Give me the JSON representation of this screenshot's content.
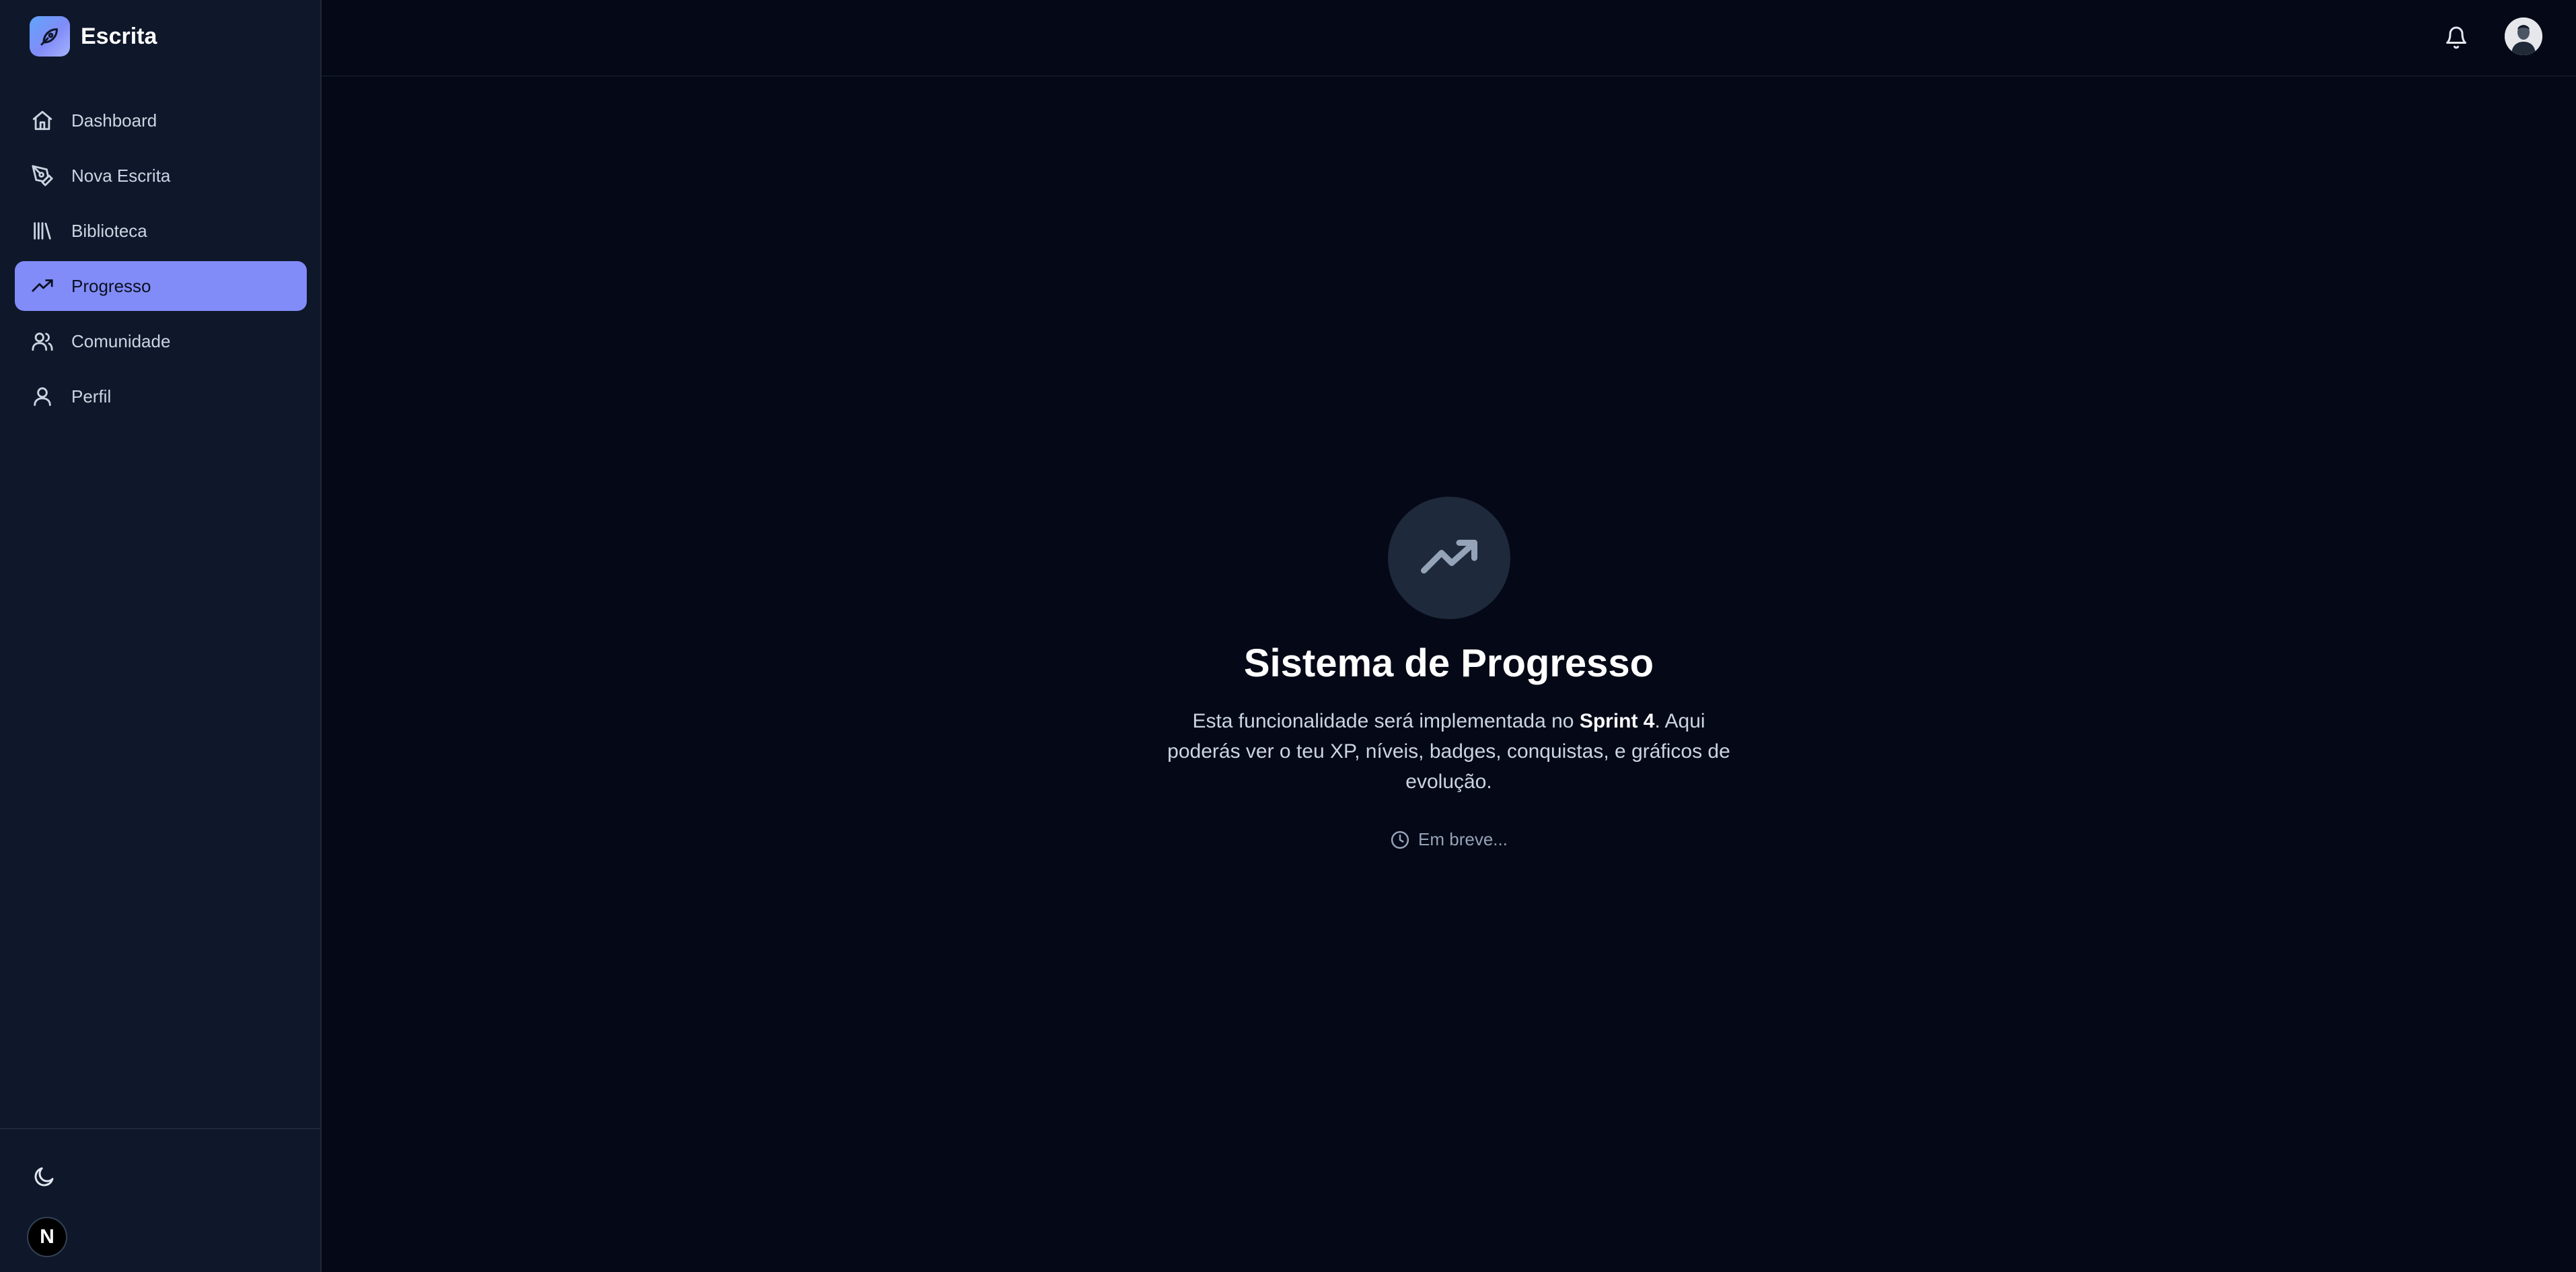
{
  "brand": {
    "name": "Escrita",
    "logo_icon": "feather-pen-icon"
  },
  "sidebar": {
    "items": [
      {
        "label": "Dashboard",
        "icon": "home-icon",
        "active": false
      },
      {
        "label": "Nova Escrita",
        "icon": "pen-tool-icon",
        "active": false
      },
      {
        "label": "Biblioteca",
        "icon": "library-icon",
        "active": false
      },
      {
        "label": "Progresso",
        "icon": "trending-up-icon",
        "active": true
      },
      {
        "label": "Comunidade",
        "icon": "users-icon",
        "active": false
      },
      {
        "label": "Perfil",
        "icon": "user-icon",
        "active": false
      }
    ],
    "footer": {
      "theme_icon": "moon-icon",
      "badge_letter": "N"
    }
  },
  "topbar": {
    "notification_icon": "bell-icon",
    "avatar_icon": "avatar"
  },
  "main": {
    "icon": "trending-up-icon",
    "title": "Sistema de Progresso",
    "description_before": "Esta funcionalidade será implementada no ",
    "description_bold": "Sprint 4",
    "description_after": ". Aqui poderás ver o teu XP, níveis, badges, conquistas, e gráficos de evolução.",
    "status_icon": "clock-icon",
    "status_text": "Em breve..."
  },
  "colors": {
    "background": "#050816",
    "sidebar": "#0f172a",
    "accent": "#818cf8",
    "text_muted": "#94a3b8"
  }
}
